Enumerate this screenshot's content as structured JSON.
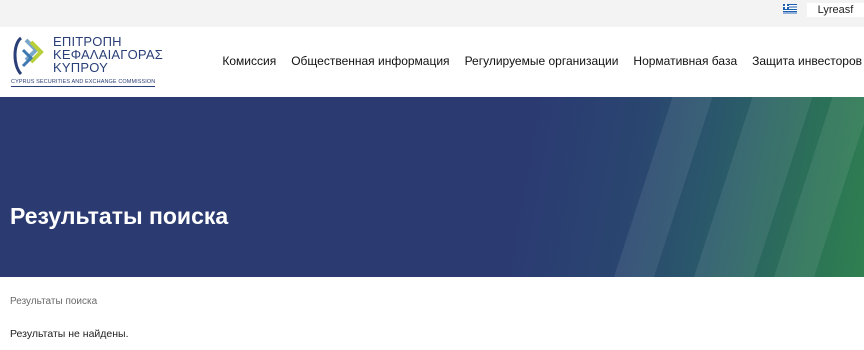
{
  "topbar": {
    "language_icon": "greek-flag-icon",
    "user_name": "Lyreasf"
  },
  "logo": {
    "line1": "ΕΠΙΤΡΟΠΗ",
    "line2": "ΚΕΦΑΛΑΙΑΓΟΡΑΣ",
    "line3": "ΚΥΠΡΟΥ",
    "subtitle": "CYPRUS SECURITIES AND EXCHANGE COMMISSION"
  },
  "nav": {
    "items": [
      {
        "label": "Комиссия"
      },
      {
        "label": "Общественная информация"
      },
      {
        "label": "Регулируемые организации"
      },
      {
        "label": "Нормативная база"
      },
      {
        "label": "Защита инвесторов"
      }
    ]
  },
  "hero": {
    "title": "Результаты поиска"
  },
  "breadcrumb": {
    "current": "Результаты поиска"
  },
  "results": {
    "message": "Результаты не найдены."
  },
  "colors": {
    "brand_blue": "#2b3b72",
    "brand_green": "#2f8050",
    "topbar_bg": "#f3f3f3"
  }
}
